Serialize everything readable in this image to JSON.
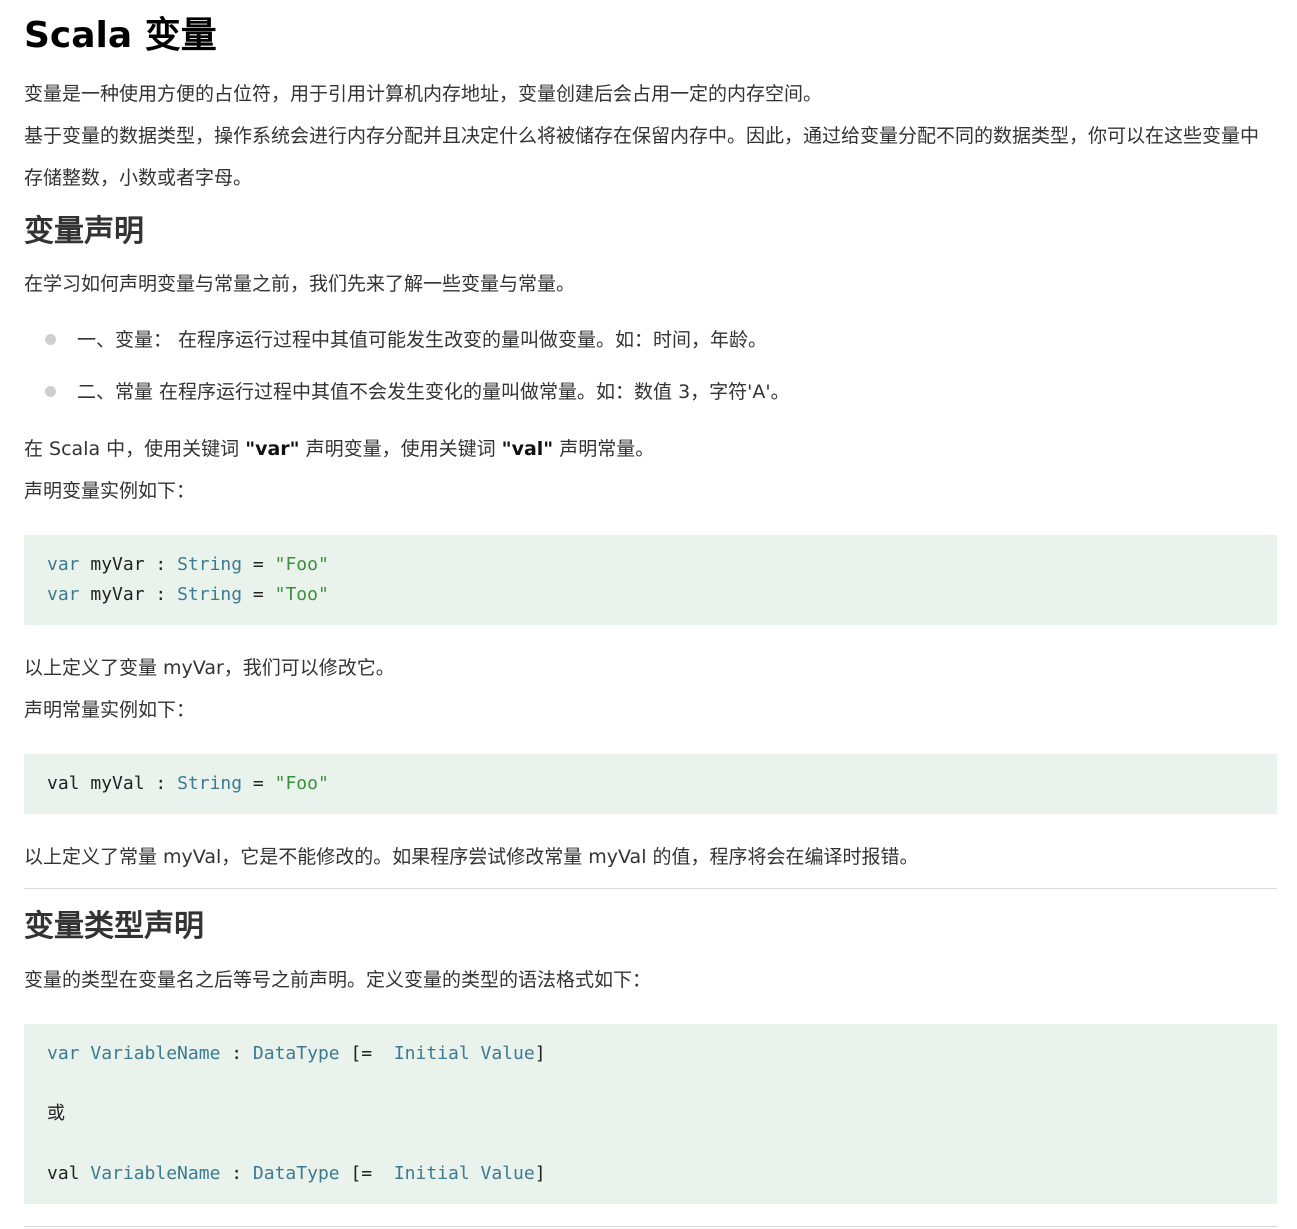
{
  "title": "Scala 变量",
  "intro": {
    "p1": "变量是一种使用方便的占位符，用于引用计算机内存地址，变量创建后会占用一定的内存空间。",
    "p2": "基于变量的数据类型，操作系统会进行内存分配并且决定什么将被储存在保留内存中。因此，通过给变量分配不同的数据类型，你可以在这些变量中存储整数，小数或者字母。"
  },
  "section1": {
    "heading": "变量声明",
    "lead": "在学习如何声明变量与常量之前，我们先来了解一些变量与常量。",
    "bullets": [
      "一、变量： 在程序运行过程中其值可能发生改变的量叫做变量。如：时间，年龄。",
      "二、常量 在程序运行过程中其值不会发生变化的量叫做常量。如：数值 3，字符'A'。"
    ],
    "keyword_line": {
      "before": "在 Scala 中，使用关键词 ",
      "kw1": "\"var\"",
      "middle": " 声明变量，使用关键词 ",
      "kw2": "\"val\"",
      "after": " 声明常量。"
    },
    "var_example_intro": "声明变量实例如下：",
    "code_var": [
      {
        "kw": "var",
        "name": " myVar ",
        "colon": ": ",
        "type": "String",
        "eq": " = ",
        "str": "\"Foo\""
      },
      {
        "kw": "var",
        "name": " myVar ",
        "colon": ": ",
        "type": "String",
        "eq": " = ",
        "str": "\"Too\""
      }
    ],
    "var_note": "以上定义了变量 myVar，我们可以修改它。",
    "val_example_intro": "声明常量实例如下：",
    "code_val": [
      {
        "kw": "val",
        "name": " myVal ",
        "colon": ": ",
        "type": "String",
        "eq": " = ",
        "str": "\"Foo\""
      }
    ],
    "val_note": "以上定义了常量 myVal，它是不能修改的。如果程序尝试修改常量 myVal 的值，程序将会在编译时报错。"
  },
  "section2": {
    "heading": "变量类型声明",
    "lead": "变量的类型在变量名之后等号之前声明。定义变量的类型的语法格式如下：",
    "code_syntax": {
      "line1": {
        "kw": "var",
        "name": "VariableName",
        "colon": " : ",
        "type": "DataType",
        "bracket_open": " [=  ",
        "init": "Initial Value",
        "bracket_close": "]"
      },
      "or": "或",
      "line2": {
        "kw": "val",
        "name": "VariableName",
        "colon": " : ",
        "type": "DataType",
        "bracket_open": " [=  ",
        "init": "Initial Value",
        "bracket_close": "]"
      }
    }
  },
  "colors": {
    "code_background": "#e9f3ec",
    "code_keyword": "#3d7a92",
    "code_string": "#3a8f3a",
    "text": "#333333"
  }
}
